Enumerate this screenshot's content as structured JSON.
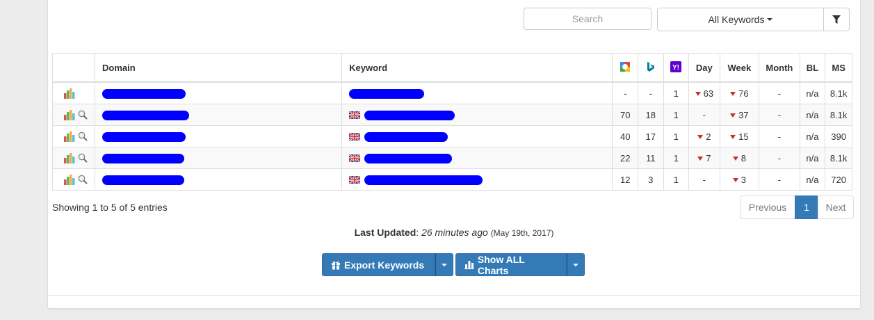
{
  "toolbar": {
    "search_placeholder": "Search",
    "keywords_dropdown": "All Keywords",
    "filter_icon": "filter-icon"
  },
  "table": {
    "headers": [
      "",
      "Domain",
      "Keyword",
      "google-icon",
      "bing-icon",
      "yahoo-icon",
      "Day",
      "Week",
      "Month",
      "BL",
      "MS"
    ],
    "labels": {
      "domain": "Domain",
      "keyword": "Keyword",
      "day": "Day",
      "week": "Week",
      "month": "Month",
      "bl": "BL",
      "ms": "MS"
    },
    "rows": [
      {
        "google": "-",
        "bing": "-",
        "yahoo": "1",
        "day": "63",
        "day_trend": "down",
        "week": "76",
        "week_trend": "down",
        "month": "-",
        "bl": "n/a",
        "ms": "8.1k"
      },
      {
        "google": "70",
        "bing": "18",
        "yahoo": "1",
        "day": "-",
        "day_trend": "none",
        "week": "37",
        "week_trend": "down",
        "month": "-",
        "bl": "n/a",
        "ms": "8.1k"
      },
      {
        "google": "40",
        "bing": "17",
        "yahoo": "1",
        "day": "2",
        "day_trend": "down",
        "week": "15",
        "week_trend": "down",
        "month": "-",
        "bl": "n/a",
        "ms": "390"
      },
      {
        "google": "22",
        "bing": "11",
        "yahoo": "1",
        "day": "7",
        "day_trend": "down",
        "week": "8",
        "week_trend": "down",
        "month": "-",
        "bl": "n/a",
        "ms": "8.1k"
      },
      {
        "google": "12",
        "bing": "3",
        "yahoo": "1",
        "day": "-",
        "day_trend": "none",
        "week": "3",
        "week_trend": "down",
        "month": "-",
        "bl": "n/a",
        "ms": "720"
      }
    ]
  },
  "info": {
    "showing": "Showing 1 to 5 of 5 entries"
  },
  "pagination": {
    "previous": "Previous",
    "current": "1",
    "next": "Next"
  },
  "status": {
    "label": "Last Updated",
    "relative": "26 minutes ago",
    "date": "(May 19th, 2017)"
  },
  "actions": {
    "export_label": "Export Keywords",
    "charts_label": "Show ALL Charts"
  },
  "colors": {
    "primary": "#337ab7",
    "trend_down": "#c9302c",
    "redaction": "#0000ff"
  }
}
